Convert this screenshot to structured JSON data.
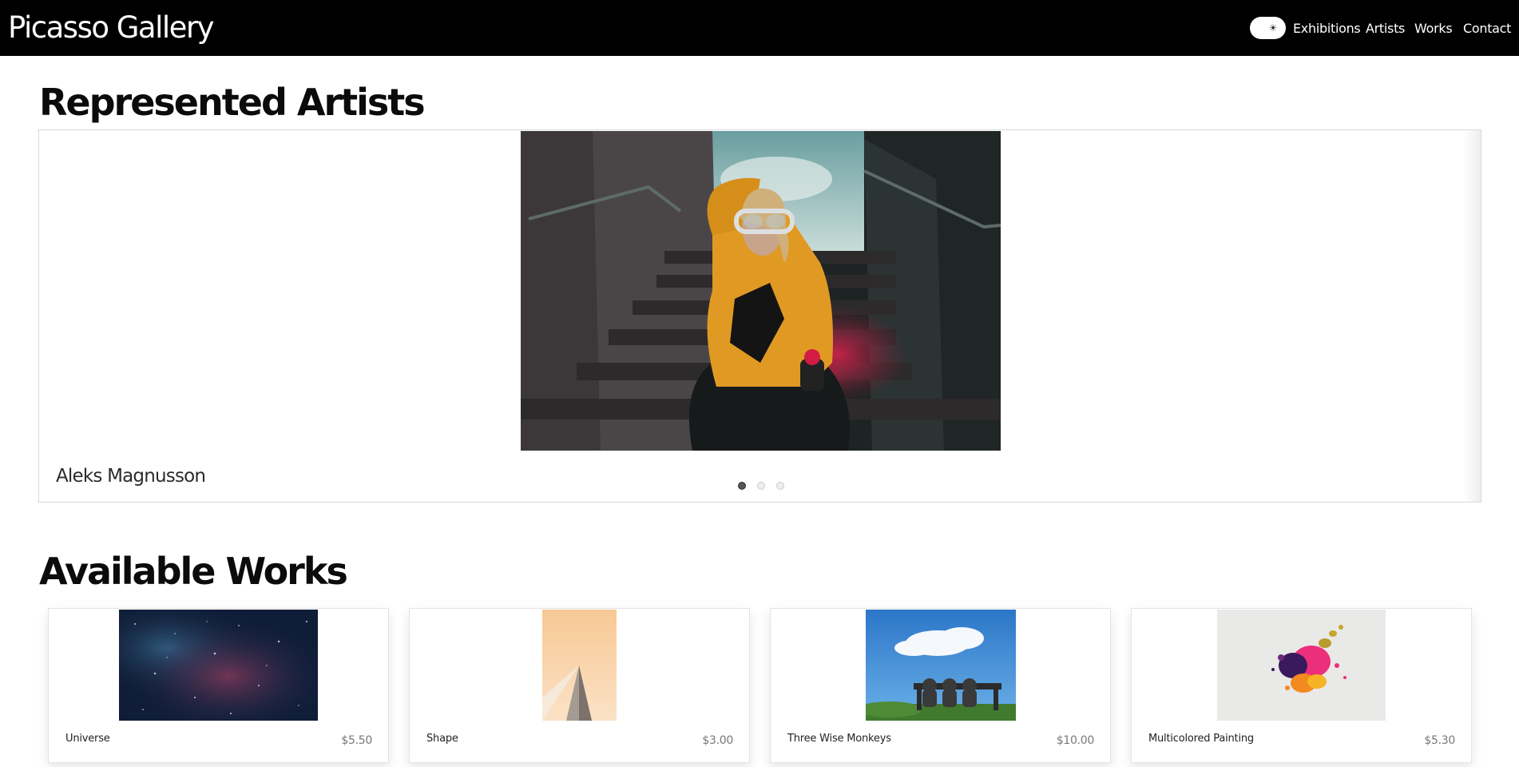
{
  "header": {
    "brand": "Picasso Gallery",
    "theme_toggle_icon": "sun-icon",
    "nav": [
      "Exhibitions",
      "Artists",
      "Works",
      "Contact"
    ]
  },
  "artists": {
    "title": "Represented Artists",
    "current_artist": "Aleks Magnusson",
    "slide_count": 3,
    "active_slide": 1
  },
  "works": {
    "title": "Available Works",
    "items": [
      {
        "title": "Universe",
        "price": "$5.50"
      },
      {
        "title": "Shape",
        "price": "$3.00"
      },
      {
        "title": "Three Wise Monkeys",
        "price": "$10.00"
      },
      {
        "title": "Multicolored Painting",
        "price": "$5.30"
      }
    ]
  },
  "colors": {
    "header_bg": "#000000",
    "page_bg": "#ffffff"
  }
}
